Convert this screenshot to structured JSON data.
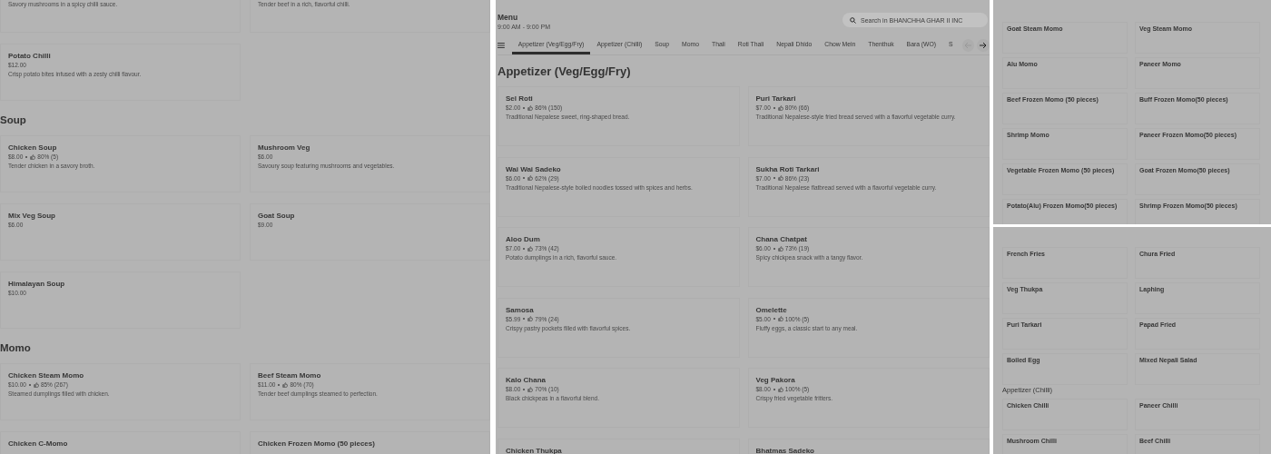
{
  "panels": [
    {
      "kind": "left",
      "sections": [
        {
          "items": [
            {
              "description": "Savory mushrooms in a spicy chilli sauce."
            },
            {
              "description": "Tender beef in a rich, flavorful chilli."
            },
            {
              "name": "Potato Chilli",
              "price": "$12.00",
              "description": "Crisp potato bites infused with a zesty chilli flavour."
            }
          ]
        },
        {
          "heading": "Soup",
          "items": [
            {
              "name": "Chicken Soup",
              "price": "$8.00",
              "rating": "80% (5)",
              "description": "Tender chicken in a savory broth."
            },
            {
              "name": "Mushroom Veg",
              "price": "$6.00",
              "description": "Savoury soup featuring mushrooms and vegetables."
            },
            {
              "name": "Mix Veg Soup",
              "price": "$6.00"
            },
            {
              "name": "Goat Soup",
              "price": "$9.00"
            },
            {
              "name": "Himalayan Soup",
              "price": "$10.00"
            }
          ]
        },
        {
          "heading": "Momo",
          "items": [
            {
              "name": "Chicken Steam Momo",
              "price": "$10.00",
              "rating": "85% (267)",
              "description": "Steamed dumplings filled with chicken."
            },
            {
              "name": "Beef Steam Momo",
              "price": "$11.00",
              "rating": "80% (70)",
              "description": "Tender beef dumplings steamed to perfection."
            },
            {
              "name": "Chicken C-Momo"
            },
            {
              "name": "Chicken Frozen Momo (50 pieces)"
            }
          ]
        }
      ]
    },
    {
      "kind": "middle",
      "title": "Menu",
      "hours": "9:00 AM - 9:00 PM",
      "search": {
        "placeholder": "Search in BHANCHHA GHAR II INC"
      },
      "tabs": [
        {
          "label": "Appetizer (Veg/Egg/Fry)",
          "selected": true
        },
        {
          "label": "Appetizer (Chilli)",
          "selected": false
        },
        {
          "label": "Soup",
          "selected": false
        },
        {
          "label": "Momo",
          "selected": false
        },
        {
          "label": "Thali",
          "selected": false
        },
        {
          "label": "Roti Thali",
          "selected": false
        },
        {
          "label": "Nepali Dhido",
          "selected": false
        },
        {
          "label": "Chow Mein",
          "selected": false
        },
        {
          "label": "Thenthuk",
          "selected": false
        },
        {
          "label": "Bara (WO)",
          "selected": false
        },
        {
          "label": "S",
          "selected": false
        }
      ],
      "scroll_buttons": [
        {
          "kind": "prev",
          "disabled": true
        },
        {
          "kind": "next",
          "disabled": false
        }
      ],
      "sections": [
        {
          "heading": "Appetizer (Veg/Egg/Fry)",
          "items": [
            {
              "name": "Sel Roti",
              "price": "$2.00",
              "rating": "86% (150)",
              "description": "Traditional Nepalese sweet, ring-shaped bread."
            },
            {
              "name": "Puri Tarkari",
              "price": "$7.00",
              "rating": "80% (66)",
              "description": "Traditional Nepalese-style fried bread served with a flavorful vegetable curry."
            },
            {
              "name": "Wai Wai Sadeko",
              "price": "$6.00",
              "rating": "62% (29)",
              "description": "Traditional Nepalese-style boiled noodles tossed with spices and herbs."
            },
            {
              "name": "Sukha Roti Tarkari",
              "price": "$7.00",
              "rating": "86% (23)",
              "description": "Traditional Nepalese flatbread served with a flavorful vegetable curry."
            },
            {
              "name": "Aloo Dum",
              "price": "$7.00",
              "rating": "73% (42)",
              "description": "Potato dumplings in a rich, flavorful sauce."
            },
            {
              "name": "Chana Chatpat",
              "price": "$6.00",
              "rating": "73% (19)",
              "description": "Spicy chickpea snack with a tangy flavor."
            },
            {
              "name": "Samosa",
              "price": "$5.99",
              "rating": "79% (24)",
              "description": "Crispy pastry pockets filled with flavorful spices."
            },
            {
              "name": "Omelette",
              "price": "$5.00",
              "rating": "100% (5)",
              "description": "Fluffy eggs, a classic start to any meal."
            },
            {
              "name": "Kalo Chana",
              "price": "$8.00",
              "rating": "70% (10)",
              "description": "Black chickpeas in a flavorful blend."
            },
            {
              "name": "Veg Pakora",
              "price": "$8.00",
              "rating": "100% (5)",
              "description": "Crispy fried vegetable fritters."
            },
            {
              "name": "Chicken Thukpa"
            },
            {
              "name": "Bhatmas Sadeko"
            }
          ]
        }
      ]
    },
    {
      "kind": "small-top",
      "sections": [
        {
          "items": [
            {
              "name": "Goat Steam Momo"
            },
            {
              "name": "Veg Steam Momo"
            },
            {
              "name": "Alu Momo"
            },
            {
              "name": "Paneer Momo"
            },
            {
              "name": "Beef Frozen Momo (50 pieces)"
            },
            {
              "name": "Buff Frozen Momo(50 pieces)"
            },
            {
              "name": "Shrimp Momo"
            },
            {
              "name": "Paneer Frozen Momo(50 pieces)"
            },
            {
              "name": "Vegetable Frozen Momo (50 pieces)"
            },
            {
              "name": "Goat Frozen Momo(50 pieces)"
            },
            {
              "name": "Potato(Alu) Frozen Momo(50 pieces)"
            },
            {
              "name": "Shrimp Frozen Momo(50 pieces)"
            }
          ]
        }
      ]
    },
    {
      "kind": "small-bottom",
      "sections": [
        {
          "items": [
            {
              "name": "French Fries"
            },
            {
              "name": "Chura Fried"
            },
            {
              "name": "Veg Thukpa"
            },
            {
              "name": "Laphing"
            },
            {
              "name": "Puri Tarkari"
            },
            {
              "name": "Papad Fried"
            },
            {
              "name": "Boiled Egg"
            },
            {
              "name": "Mixed Nepali Salad"
            }
          ]
        },
        {
          "heading": "Appetizer (Chilli)",
          "items": [
            {
              "name": "Chicken Chilli"
            },
            {
              "name": "Paneer Chilli"
            },
            {
              "name": "Mushroom Chilli"
            },
            {
              "name": "Beef Chilli"
            }
          ]
        }
      ]
    }
  ]
}
